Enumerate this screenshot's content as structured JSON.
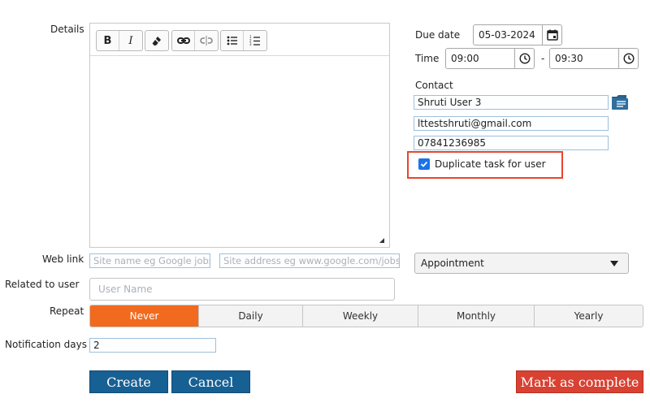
{
  "labels": {
    "details": "Details",
    "due_date": "Due date",
    "time": "Time",
    "contact": "Contact",
    "web_link": "Web link",
    "related_to_user": "Related to user",
    "repeat": "Repeat",
    "notification_days": "Notification days"
  },
  "toolbar": [
    "B",
    "I",
    "clear-format",
    "link",
    "unlink",
    "bullet-list",
    "numbered-list"
  ],
  "due_date": "05-03-2024",
  "time": {
    "start": "09:00",
    "separator": "-",
    "end": "09:30"
  },
  "contact": {
    "name": "Shruti User 3",
    "email": "lttestshruti@gmail.com",
    "phone": "07841236985"
  },
  "duplicate_label": "Duplicate task for user",
  "web_link": {
    "name_placeholder": "Site name eg Google jobs",
    "address_placeholder": "Site address eg www.google.com/jobs"
  },
  "type_select": "Appointment",
  "user_placeholder": "User Name",
  "repeat_options": [
    "Never",
    "Daily",
    "Weekly",
    "Monthly",
    "Yearly"
  ],
  "notification_days": "2",
  "buttons": {
    "create": "Create",
    "cancel": "Cancel",
    "mark_complete": "Mark as complete"
  },
  "colors": {
    "accent_orange": "#f26a1d",
    "primary_blue": "#176094",
    "danger_red": "#d94132",
    "highlight_border": "#e8452e"
  }
}
